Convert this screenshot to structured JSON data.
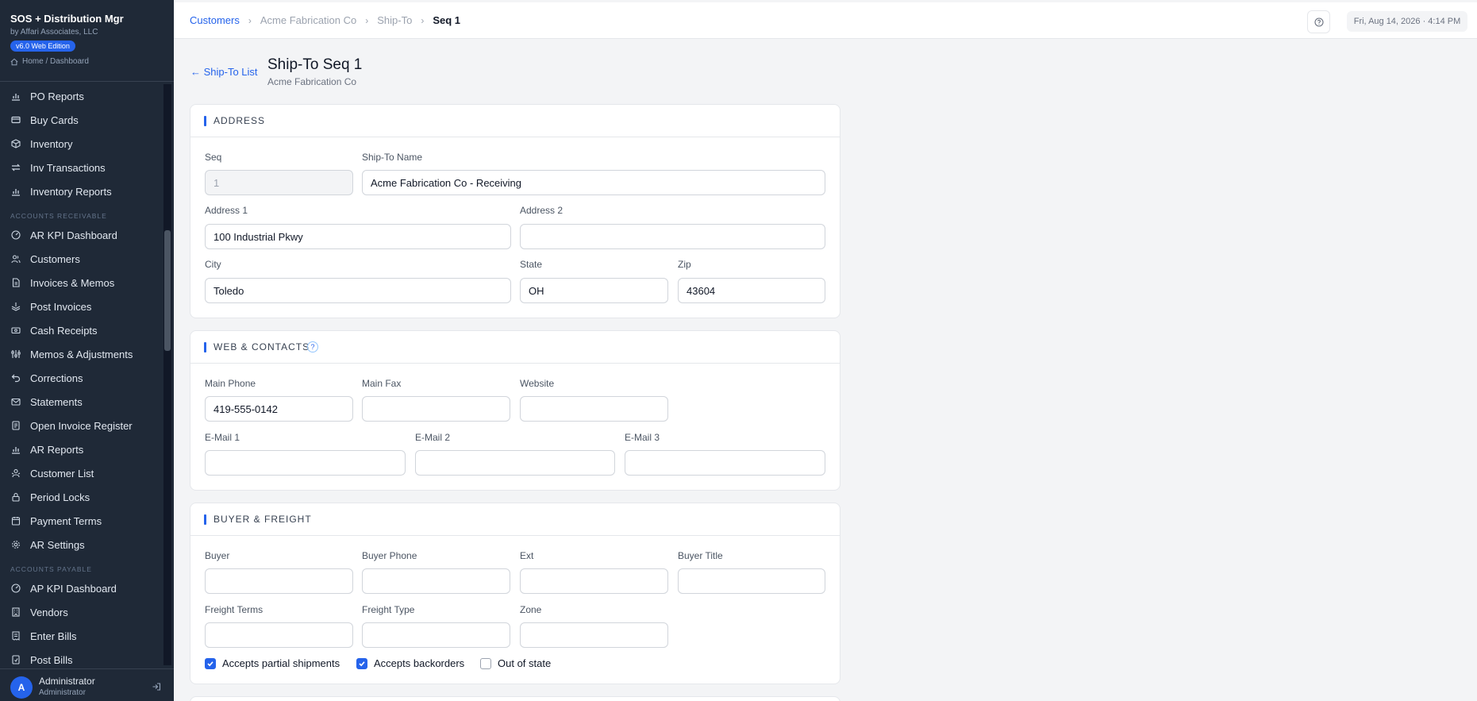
{
  "sidebar": {
    "brand_title": "SOS + Distribution Mgr",
    "brand_sub": "by Affari Associates, LLC",
    "edition": "v6.0 Web Edition",
    "home_link": "Home / Dashboard",
    "items": [
      {
        "label": "PO Reports",
        "icon": "bar-chart-icon"
      },
      {
        "label": "Buy Cards",
        "icon": "card-icon"
      },
      {
        "label": "Inventory",
        "icon": "box-icon"
      },
      {
        "label": "Inv Transactions",
        "icon": "arrows-icon"
      },
      {
        "label": "Inventory Reports",
        "icon": "bar-chart-icon"
      },
      {
        "label": "AR KPI Dashboard",
        "icon": "gauge-icon"
      },
      {
        "label": "Customers",
        "icon": "users-icon"
      },
      {
        "label": "Invoices & Memos",
        "icon": "file-icon"
      },
      {
        "label": "Post Invoices",
        "icon": "stack-icon"
      },
      {
        "label": "Cash Receipts",
        "icon": "cash-icon"
      },
      {
        "label": "Memos & Adjustments",
        "icon": "sliders-icon"
      },
      {
        "label": "Corrections",
        "icon": "undo-icon"
      },
      {
        "label": "Statements",
        "icon": "mail-icon"
      },
      {
        "label": "Open Invoice Register",
        "icon": "register-icon"
      },
      {
        "label": "AR Reports",
        "icon": "bar-chart-icon"
      },
      {
        "label": "Customer List",
        "icon": "people-icon"
      },
      {
        "label": "Period Locks",
        "icon": "lock-icon"
      },
      {
        "label": "Payment Terms",
        "icon": "calendar-icon"
      },
      {
        "label": "AR Settings",
        "icon": "gear-icon"
      },
      {
        "label": "AP KPI Dashboard",
        "icon": "gauge-icon"
      },
      {
        "label": "Vendors",
        "icon": "building-icon"
      },
      {
        "label": "Enter Bills",
        "icon": "receipt-icon"
      },
      {
        "label": "Post Bills",
        "icon": "post-icon"
      }
    ],
    "section_ar": "ACCOUNTS RECEIVABLE",
    "section_ap": "ACCOUNTS PAYABLE",
    "user_initial": "A",
    "user_name": "Administrator",
    "user_role": "Administrator"
  },
  "topbar": {
    "crumbs": [
      "Customers",
      "Acme Fabrication Co",
      "Ship-To",
      "Seq 1"
    ],
    "datetime": "Fri, Aug 14, 2026 · 4:14 PM"
  },
  "page": {
    "back_label": "← Ship-To List",
    "title": "Ship-To Seq 1",
    "subtitle": "Acme Fabrication Co"
  },
  "address": {
    "title": "ADDRESS",
    "seq_label": "Seq",
    "seq_value": "1",
    "name_label": "Ship-To Name",
    "name_value": "Acme Fabrication Co - Receiving",
    "addr1_label": "Address 1",
    "addr1_value": "100 Industrial Pkwy",
    "addr2_label": "Address 2",
    "addr2_value": "",
    "city_label": "City",
    "city_value": "Toledo",
    "state_label": "State",
    "state_value": "OH",
    "zip_label": "Zip",
    "zip_value": "43604"
  },
  "web": {
    "title": "WEB & CONTACTS",
    "help": "?",
    "phone_label": "Main Phone",
    "phone_value": "419-555-0142",
    "fax_label": "Main Fax",
    "fax_value": "",
    "web_label": "Website",
    "web_value": "",
    "email1_label": "E-Mail 1",
    "email1_value": "",
    "email2_label": "E-Mail 2",
    "email2_value": "",
    "email3_label": "E-Mail 3",
    "email3_value": ""
  },
  "buyer": {
    "title": "BUYER & FREIGHT",
    "buyer_label": "Buyer",
    "buyer_value": "",
    "bphone_label": "Buyer Phone",
    "bphone_value": "",
    "ext_label": "Ext",
    "ext_value": "",
    "btitle_label": "Buyer Title",
    "btitle_value": "",
    "fterms_label": "Freight Terms",
    "fterms_value": "",
    "ftype_label": "Freight Type",
    "ftype_value": "",
    "zone_label": "Zone",
    "zone_value": "",
    "checks": [
      {
        "label": "Accepts partial shipments",
        "checked": true
      },
      {
        "label": "Accepts backorders",
        "checked": true
      },
      {
        "label": "Out of state",
        "checked": false
      }
    ]
  },
  "colors": {
    "accent": "#2563eb",
    "sidebar_bg": "#1f2937"
  }
}
